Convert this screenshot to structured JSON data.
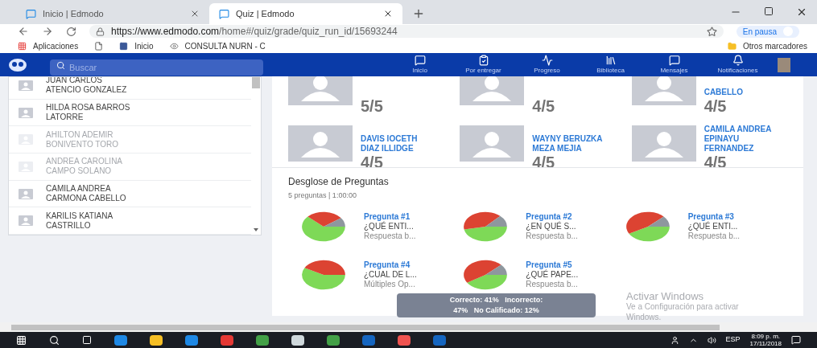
{
  "browser": {
    "tabs": [
      {
        "label": "Inicio | Edmodo",
        "selected": false
      },
      {
        "label": "Quiz | Edmodo",
        "selected": true
      }
    ],
    "url": {
      "host": "https://www.edmodo.com",
      "path": "/home#/quiz/grade/quiz_run_id/15693244"
    },
    "profile": "En pausa",
    "bookmarks": [
      {
        "label": "Aplicaciones",
        "kind": "apps"
      },
      {
        "kind": "page"
      },
      {
        "label": "Inicio",
        "kind": "facebook"
      },
      {
        "label": "CONSULTA NURN - C",
        "kind": "eye"
      }
    ],
    "other_bookmarks": "Otros marcadores"
  },
  "nav": {
    "search": {
      "placeholder": "Buscar"
    },
    "items": [
      "Inicio",
      "Por entregar",
      "Progreso",
      "Biblioteca",
      "Mensajes",
      "Notificaciones"
    ]
  },
  "students": [
    {
      "name": "JUAN CARLOS ATENCIO GONZALEZ",
      "disabled": false
    },
    {
      "name": "HILDA ROSA BARROS LATORRE",
      "disabled": false
    },
    {
      "name": "AHILTON ADEMIR BONIVENTO TORO",
      "disabled": true
    },
    {
      "name": "ANDREA CAROLINA CAMPO SOLANO",
      "disabled": true
    },
    {
      "name": "CAMILA ANDREA CARMONA CABELLO",
      "disabled": false
    },
    {
      "name": "KARILIS KATIANA CASTRILLO",
      "disabled": false
    }
  ],
  "scores": [
    {
      "score": "5/5"
    },
    {
      "score": "4/5"
    },
    {
      "name": "CABELLO",
      "score": "4/5"
    },
    {
      "name": "DAVIS IOCETH DIAZ ILLIDGE",
      "score": "4/5"
    },
    {
      "name": "WAYNY BERUZKA MEZA MEJIA",
      "score": "4/5"
    },
    {
      "name": "CAMILA ANDREA EPINAYU FERNANDEZ",
      "score": "4/5"
    }
  ],
  "breakdown": {
    "title": "Desglose de Preguntas",
    "subtitle": "5 preguntas | 1:00:00",
    "questions": [
      {
        "label": "Pregunta #1",
        "text": "¿QUÉ ENTI...",
        "type": "Respuesta b..."
      },
      {
        "label": "Pregunta #2",
        "text": "¿EN QUÉ S...",
        "type": "Respuesta b..."
      },
      {
        "label": "Pregunta #3",
        "text": "¿QUÉ ENTI...",
        "type": "Respuesta b..."
      },
      {
        "label": "Pregunta #4",
        "text": "¿CUAL DE L...",
        "type": "Múltiples Op..."
      },
      {
        "label": "Pregunta #5",
        "text": "¿QUÉ PAPE...",
        "type": "Respuesta b..."
      }
    ],
    "tooltip": [
      "Correcto: 41%   Incorrecto:",
      "47%   No Calificado: 12%"
    ]
  },
  "watermark": {
    "title": "Activar Windows",
    "text": "Ve a Configuración para activar",
    "text2": "Windows."
  },
  "taskbar": {
    "language": "ESP",
    "time": "8:09 p. m.",
    "date": "17/11/2018"
  }
}
